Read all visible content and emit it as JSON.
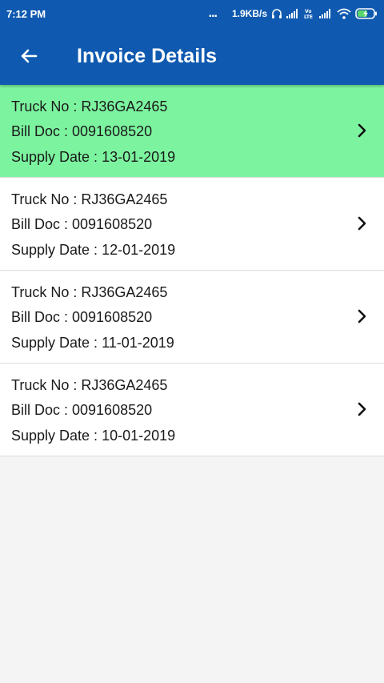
{
  "status_bar": {
    "time": "7:12 PM",
    "more": "...",
    "speed": "1.9KB/s",
    "icons": [
      "headphones-icon",
      "signal-icon",
      "volte-icon",
      "signal-icon",
      "wifi-icon",
      "battery-charging-icon"
    ]
  },
  "app_bar": {
    "title": "Invoice Details",
    "back_icon": "arrow-left-icon",
    "color": "#0f5ab0"
  },
  "invoices": [
    {
      "truck_no": "Truck No : RJ36GA2465",
      "bill_doc": "Bill Doc : 0091608520",
      "supply_date": "Supply Date : 13-01-2019",
      "selected": true
    },
    {
      "truck_no": "Truck No : RJ36GA2465",
      "bill_doc": "Bill Doc : 0091608520",
      "supply_date": "Supply Date : 12-01-2019",
      "selected": false
    },
    {
      "truck_no": "Truck No : RJ36GA2465",
      "bill_doc": "Bill Doc : 0091608520",
      "supply_date": "Supply Date : 11-01-2019",
      "selected": false
    },
    {
      "truck_no": "Truck No : RJ36GA2465",
      "bill_doc": "Bill Doc : 0091608520",
      "supply_date": "Supply Date : 10-01-2019",
      "selected": false
    }
  ],
  "colors": {
    "selected_row": "#7cf49f",
    "row": "#ffffff",
    "background": "#f4f4f4"
  }
}
